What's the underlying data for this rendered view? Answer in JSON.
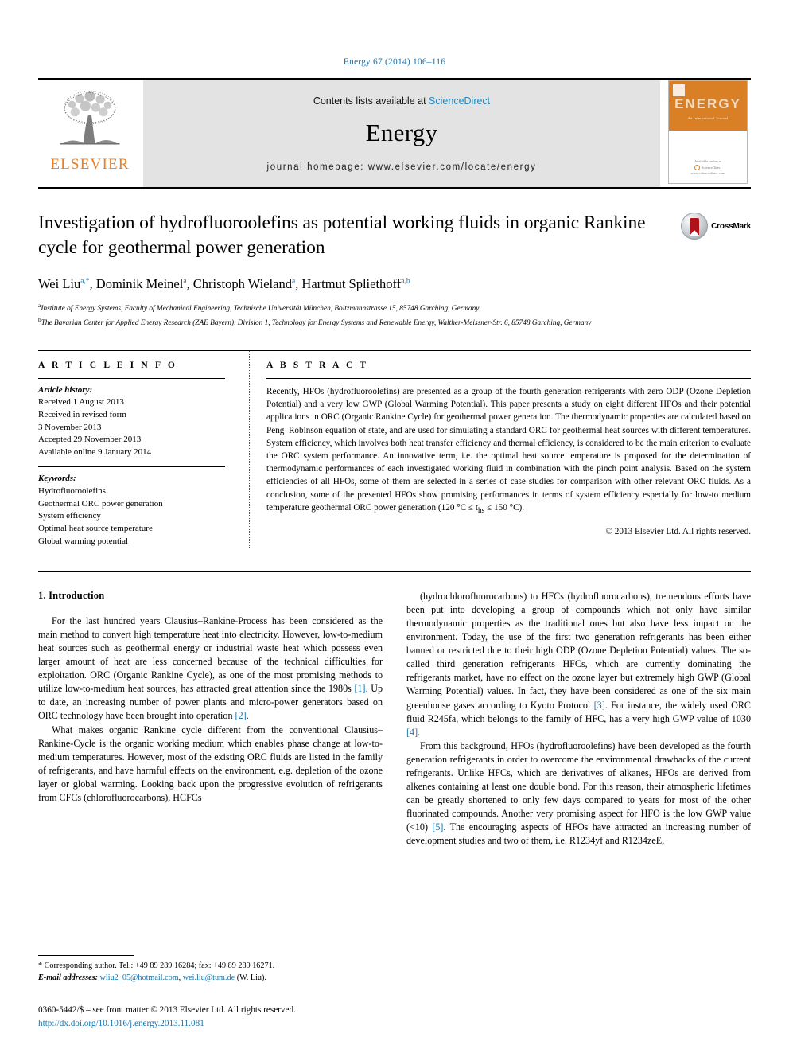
{
  "running_head": "Energy 67 (2014) 106–116",
  "masthead": {
    "publisher_name": "ELSEVIER",
    "contents_prefix": "Contents lists available at",
    "sciencedirect": "ScienceDirect",
    "journal_title": "Energy",
    "homepage": "journal homepage: www.elsevier.com/locate/energy",
    "cover": {
      "masthead_word": "ENERGY",
      "tagline": "An International Journal",
      "footer_line1": "Available online at",
      "footer_line2": "ScienceDirect",
      "footer_line3": "www.sciencedirect.com"
    }
  },
  "article": {
    "title": "Investigation of hydrofluoroolefins as potential working fluids in organic Rankine cycle for geothermal power generation",
    "authors": [
      {
        "name": "Wei Liu",
        "sup": "a,",
        "star": "*"
      },
      {
        "name": "Dominik Meinel",
        "sup": "a"
      },
      {
        "name": "Christoph Wieland",
        "sup": "a"
      },
      {
        "name": "Hartmut Spliethoff",
        "sup": "a,b"
      }
    ],
    "affiliations": [
      {
        "marker": "a",
        "text": "Institute of Energy Systems, Faculty of Mechanical Engineering, Technische Universität München, Boltzmannstrasse 15, 85748 Garching, Germany"
      },
      {
        "marker": "b",
        "text": "The Bavarian Center for Applied Energy Research (ZAE Bayern), Division 1, Technology for Energy Systems and Renewable Energy, Walther-Meissner-Str. 6, 85748 Garching, Germany"
      }
    ],
    "crossmark_label": "CrossMark"
  },
  "article_info": {
    "heading": "A R T I C L E  I N F O",
    "history_label": "Article history:",
    "history": [
      "Received 1 August 2013",
      "Received in revised form",
      "3 November 2013",
      "Accepted 29 November 2013",
      "Available online 9 January 2014"
    ],
    "keywords_label": "Keywords:",
    "keywords": [
      "Hydrofluoroolefins",
      "Geothermal ORC power generation",
      "System efficiency",
      "Optimal heat source temperature",
      "Global warming potential"
    ]
  },
  "abstract": {
    "heading": "A B S T R A C T",
    "text": "Recently, HFOs (hydrofluoroolefins) are presented as a group of the fourth generation refrigerants with zero ODP (Ozone Depletion Potential) and a very low GWP (Global Warming Potential). This paper presents a study on eight different HFOs and their potential applications in ORC (Organic Rankine Cycle) for geothermal power generation. The thermodynamic properties are calculated based on Peng–Robinson equation of state, and are used for simulating a standard ORC for geothermal heat sources with different temperatures. System efficiency, which involves both heat transfer efficiency and thermal efficiency, is considered to be the main criterion to evaluate the ORC system performance. An innovative term, i.e. the optimal heat source temperature is proposed for the determination of thermodynamic performances of each investigated working fluid in combination with the pinch point analysis. Based on the system efficiencies of all HFOs, some of them are selected in a series of case studies for comparison with other relevant ORC fluids. As a conclusion, some of the presented HFOs show promising performances in terms of system efficiency especially for low-to medium temperature geothermal ORC power generation (120 °C ≤ t",
    "text_sub": "hs",
    "text_tail": " ≤ 150 °C).",
    "copyright": "© 2013 Elsevier Ltd. All rights reserved."
  },
  "body": {
    "section_number_title": "1.  Introduction",
    "left_paragraphs": [
      "For the last hundred years Clausius–Rankine-Process has been considered as the main method to convert high temperature heat into electricity. However, low-to-medium heat sources such as geothermal energy or industrial waste heat which possess even larger amount of heat are less concerned because of the technical difficulties for exploitation. ORC (Organic Rankine Cycle), as one of the most promising methods to utilize low-to-medium heat sources, has attracted great attention since the 1980s [1]. Up to date, an increasing number of power plants and micro-power generators based on ORC technology have been brought into operation [2].",
      "What makes organic Rankine cycle different from the conventional Clausius–Rankine-Cycle is the organic working medium which enables phase change at low-to-medium temperatures. However, most of the existing ORC fluids are listed in the family of refrigerants, and have harmful effects on the environment, e.g. depletion of the ozone layer or global warming. Looking back upon the progressive evolution of refrigerants from CFCs (chlorofluorocarbons), HCFCs"
    ],
    "right_paragraphs": [
      "(hydrochlorofluorocarbons) to HFCs (hydrofluorocarbons), tremendous efforts have been put into developing a group of compounds which not only have similar thermodynamic properties as the traditional ones but also have less impact on the environment. Today, the use of the first two generation refrigerants has been either banned or restricted due to their high ODP (Ozone Depletion Potential) values. The so-called third generation refrigerants HFCs, which are currently dominating the refrigerants market, have no effect on the ozone layer but extremely high GWP (Global Warming Potential) values. In fact, they have been considered as one of the six main greenhouse gases according to Kyoto Protocol [3]. For instance, the widely used ORC fluid R245fa, which belongs to the family of HFC, has a very high GWP value of 1030 [4].",
      "From this background, HFOs (hydrofluoroolefins) have been developed as the fourth generation refrigerants in order to overcome the environmental drawbacks of the current refrigerants. Unlike HFCs, which are derivatives of alkanes, HFOs are derived from alkenes containing at least one double bond. For this reason, their atmospheric lifetimes can be greatly shortened to only few days compared to years for most of the other fluorinated compounds. Another very promising aspect for HFO is the low GWP value (<10) [5]. The encouraging aspects of HFOs have attracted an increasing number of development studies and two of them, i.e. R1234yf and R1234zeE,"
    ]
  },
  "footnote": {
    "corresponding": "* Corresponding author. Tel.: +49 89 289 16284; fax: +49 89 289 16271.",
    "email_label": "E-mail addresses:",
    "email1": "wliu2_05@hotmail.com",
    "email_sep": ", ",
    "email2": "wei.liu@tum.de",
    "email_suffix": " (W. Liu)."
  },
  "footer": {
    "issn_line": "0360-5442/$ – see front matter © 2013 Elsevier Ltd. All rights reserved.",
    "doi": "http://dx.doi.org/10.1016/j.energy.2013.11.081"
  },
  "colors": {
    "link_blue": "#1a74a8",
    "elsevier_orange": "#f07c1a",
    "banner_grey": "#e3e3e3",
    "cover_orange": "#d98026"
  }
}
